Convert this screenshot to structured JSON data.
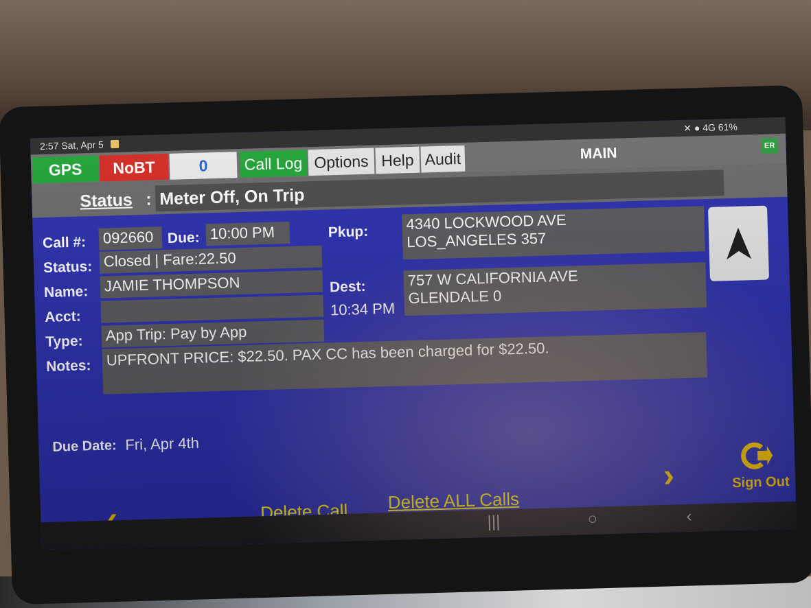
{
  "system_bar": {
    "time": "2:57",
    "date": "Sat, Apr 5",
    "status_icons": "4G",
    "battery": "61%"
  },
  "toolbar": {
    "gps": "GPS",
    "nobt": "NoBT",
    "counter": "0",
    "call_log": "Call Log",
    "options": "Options",
    "help": "Help",
    "audit": "Audit",
    "title": "MAIN",
    "badge": "ER"
  },
  "status": {
    "label": "Status",
    "value": "Meter Off, On Trip"
  },
  "call": {
    "call_no_label": "Call #:",
    "call_no": "092660",
    "due_label": "Due:",
    "due": "10:00 PM",
    "status_label": "Status:",
    "status": "Closed | Fare:22.50",
    "name_label": "Name:",
    "name": "JAMIE THOMPSON",
    "acct_label": "Acct:",
    "acct": "",
    "type_label": "Type:",
    "type": "App Trip: Pay by App",
    "notes_label": "Notes:",
    "notes": "UPFRONT PRICE: $22.50. PAX CC has been charged for $22.50.",
    "pkup_label": "Pkup:",
    "pkup_line1": "4340 LOCKWOOD AVE",
    "pkup_line2": "LOS_ANGELES 357",
    "dest_label": "Dest:",
    "dest_time": "10:34 PM",
    "dest_line1": "757 W CALIFORNIA AVE",
    "dest_line2": "GLENDALE 0",
    "due_date_label": "Due Date:",
    "due_date": "Fri, Apr 4th"
  },
  "actions": {
    "delete_call": "Delete Call",
    "delete_all": "Delete ALL Calls",
    "sign_out": "Sign Out"
  },
  "colors": {
    "panel_blue": "#2b2fae",
    "gps_green": "#1fa334",
    "nobt_red": "#d42a22",
    "link_yellow": "#f2e600"
  }
}
